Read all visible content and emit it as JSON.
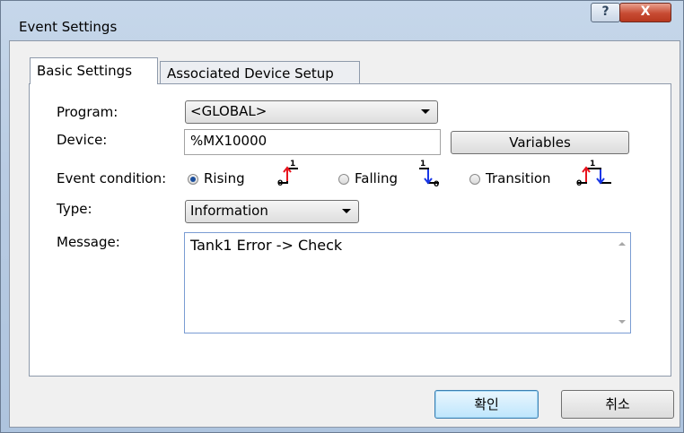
{
  "window": {
    "title": "Event Settings",
    "help_label": "?",
    "close_label": "X"
  },
  "tabs": [
    {
      "label": "Basic Settings",
      "active": true
    },
    {
      "label": "Associated Device Setup",
      "active": false
    }
  ],
  "form": {
    "program": {
      "label": "Program:",
      "value": "<GLOBAL>"
    },
    "device": {
      "label": "Device:",
      "value": "%MX10000",
      "variables_button": "Variables"
    },
    "event_condition": {
      "label": "Event condition:",
      "options": [
        {
          "label": "Rising",
          "checked": true,
          "icon": "rising-edge-icon"
        },
        {
          "label": "Falling",
          "checked": false,
          "icon": "falling-edge-icon"
        },
        {
          "label": "Transition",
          "checked": false,
          "icon": "transition-edge-icon"
        }
      ]
    },
    "type": {
      "label": "Type:",
      "value": "Information"
    },
    "message": {
      "label": "Message:",
      "value": "Tank1 Error -> Check"
    }
  },
  "footer": {
    "ok_label": "확인",
    "cancel_label": "취소"
  },
  "colors": {
    "rising": "#e8141e",
    "falling": "#1836e6",
    "accent": "#3c7fb1"
  }
}
